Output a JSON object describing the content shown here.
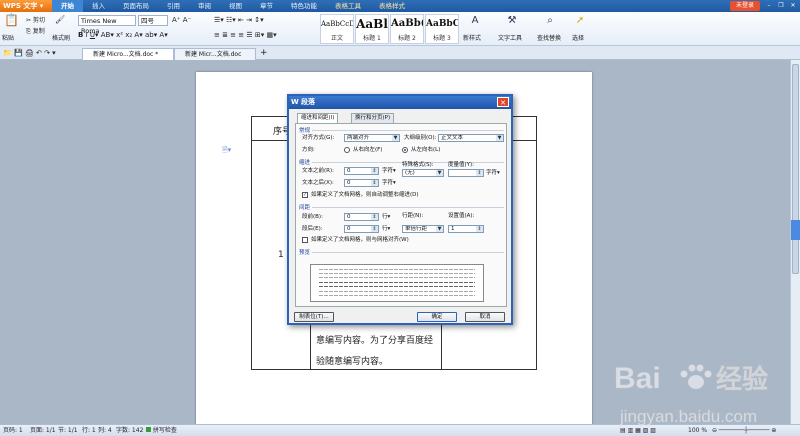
{
  "app": {
    "title": "WPS 文字",
    "login_label": "未登录",
    "menu": [
      "开始",
      "插入",
      "页面布局",
      "引用",
      "审阅",
      "视图",
      "章节",
      "特色功能",
      "表格工具",
      "表格样式"
    ],
    "active_menu": "开始"
  },
  "ribbon": {
    "paste_label": "粘贴",
    "cut_label": "剪切",
    "copy_label": "复制",
    "format_painter_label": "格式刷",
    "font_name": "Times New Roma",
    "font_size": "四号",
    "styles": [
      {
        "sample": "AaBbCcDd",
        "name": "正文"
      },
      {
        "sample": "AaBl",
        "name": "标题 1"
      },
      {
        "sample": "AaBb(",
        "name": "标题 2"
      },
      {
        "sample": "AaBbC",
        "name": "标题 3"
      }
    ],
    "new_style_label": "新样式",
    "text_tools_label": "文字工具",
    "find_replace_label": "查找替换",
    "select_label": "选择"
  },
  "tabs": [
    {
      "label": "新建 Micro...文档.doc *"
    },
    {
      "label": "新建 Micr...文档.doc"
    }
  ],
  "document": {
    "header_cell": "序号",
    "row_number": "1",
    "body_line_1": "意编写内容。为了分享百度经",
    "body_line_2": "验随意编写内容。"
  },
  "dialog": {
    "title": "段落",
    "tabs": [
      "缩进和间距(I)",
      "换行和分页(P)"
    ],
    "general_section": "常规",
    "alignment_label": "对齐方式(G):",
    "alignment_value": "两端对齐",
    "outline_label": "大纲级别(O):",
    "outline_value": "正文文本",
    "direction_label": "方向:",
    "direction_rtl": "从右向左(F)",
    "direction_ltr": "从左向右(L)",
    "indent_section": "缩进",
    "before_text_label": "文本之前(R):",
    "before_text_value": "0",
    "before_text_unit": "字符▾",
    "special_label": "特殊格式(S):",
    "special_value": "(无)",
    "measure_label": "度量值(Y):",
    "measure_unit": "字符▾",
    "after_text_label": "文本之后(X):",
    "after_text_value": "0",
    "after_text_unit": "字符▾",
    "auto_indent_label": "如果定义了文档网格，则自动调整右缩进(D)",
    "spacing_section": "间距",
    "before_label": "段前(B):",
    "before_value": "0",
    "before_unit": "行▾",
    "line_spacing_label": "行距(N):",
    "line_spacing_value": "单倍行距",
    "setting_label": "设置值(A):",
    "setting_value": "1",
    "after_label": "段后(E):",
    "after_value": "0",
    "after_unit": "行▾",
    "align_grid_label": "如果定义了文档网格，则与网格对齐(W)",
    "preview_section": "预览",
    "tabs_button": "制表位(T)...",
    "ok_button": "确定",
    "cancel_button": "取消"
  },
  "statusbar": {
    "page": "页码: 1",
    "pages": "页面: 1/1",
    "section": "节: 1/1",
    "line": "行: 1",
    "column": "列: 4",
    "words": "字数: 142",
    "spellcheck": "拼写检查",
    "zoom": "100 %"
  },
  "watermark": {
    "brand": "Baidu经验",
    "url": "jingyan.baidu.com"
  },
  "colors": {
    "titlebar": "#1f5aa0",
    "app_button": "#e56e09",
    "dialog_border": "#2c63b8",
    "section_text": "#1a3f9c"
  }
}
